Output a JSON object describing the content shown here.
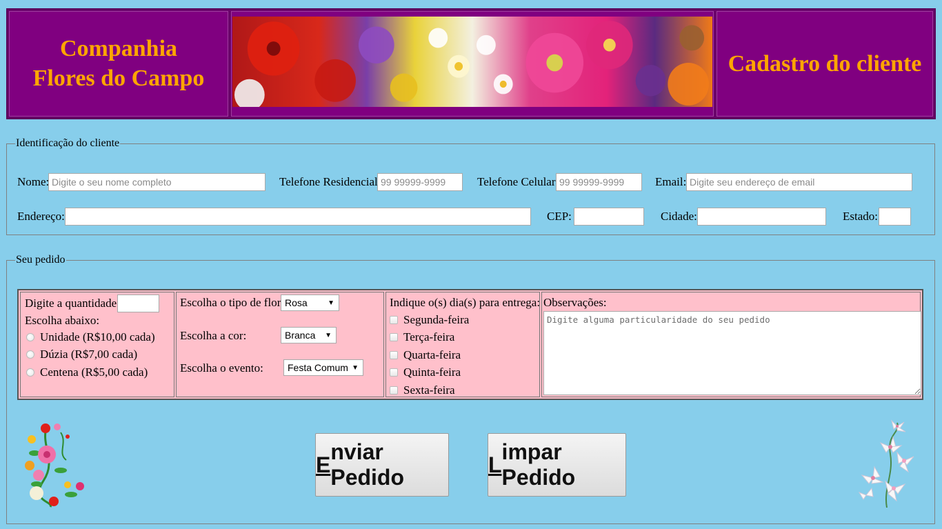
{
  "header": {
    "brand_line1": "Companhia",
    "brand_line2": "Flores do Campo",
    "banner_image": "flowers-banner",
    "page_title": "Cadastro do cliente"
  },
  "identification": {
    "legend": "Identificação do cliente",
    "name_label": "Nome:",
    "name_placeholder": "Digite o seu nome completo",
    "home_phone_label": "Telefone Residencial:",
    "home_phone_placeholder": "99 99999-9999",
    "cell_phone_label": "Telefone Celular:",
    "cell_phone_placeholder": "99 99999-9999",
    "email_label": "Email:",
    "email_placeholder": "Digite seu endereço de email",
    "address_label": "Endereço:",
    "cep_label": "CEP:",
    "city_label": "Cidade:",
    "state_label": "Estado:"
  },
  "order": {
    "legend": "Seu pedido",
    "quantity_label": "Digite a quantidade:",
    "choose_below": "Escolha abaixo:",
    "units": [
      {
        "label": "Unidade (R$10,00 cada)"
      },
      {
        "label": "Dúzia (R$7,00 cada)"
      },
      {
        "label": "Centena (R$5,00 cada)"
      }
    ],
    "flower_type_label": "Escolha o tipo de flor:",
    "flower_type_value": "Rosa",
    "color_label": "Escolha a cor:",
    "color_value": "Branca",
    "event_label": "Escolha o evento:",
    "event_value": "Festa Comum",
    "delivery_label": "Indique o(s) dia(s) para entrega:",
    "days": [
      {
        "label": "Segunda-feira"
      },
      {
        "label": "Terça-feira"
      },
      {
        "label": "Quarta-feira"
      },
      {
        "label": "Quinta-feira"
      },
      {
        "label": "Sexta-feira"
      }
    ],
    "notes_label": "Observações:",
    "notes_placeholder": "Digite alguma particularidade do seu pedido"
  },
  "buttons": {
    "send_access_key": "E",
    "send_rest": "nviar Pedido",
    "clear_access_key": "L",
    "clear_rest": "impar Pedido"
  },
  "decorations": {
    "left_icon": "flower-bouquet-icon",
    "right_icon": "lily-bouquet-icon"
  },
  "colors": {
    "background": "#87ceeb",
    "header_bg": "#800080",
    "header_text": "#ffa500",
    "order_table_bg": "#ffc0cb"
  }
}
